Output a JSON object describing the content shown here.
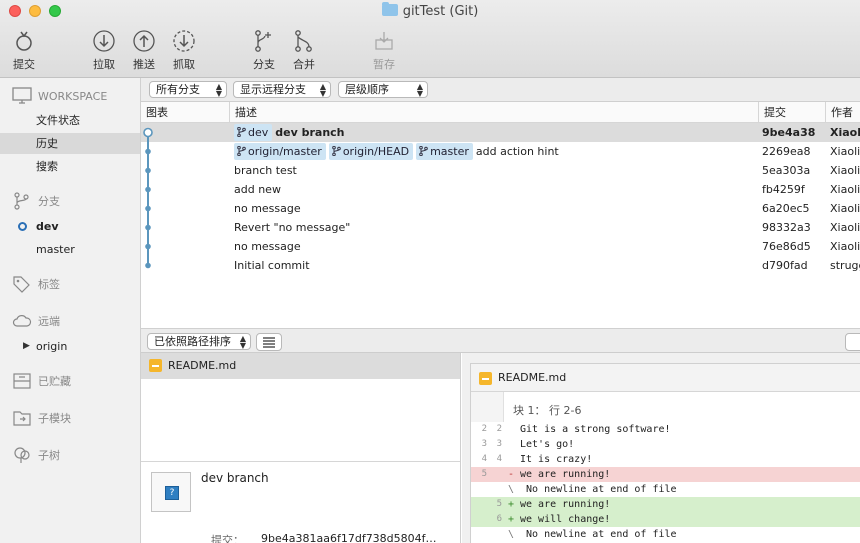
{
  "window": {
    "title": "gitTest (Git)"
  },
  "toolbar": {
    "commit": "提交",
    "pull": "拉取",
    "push": "推送",
    "fetch": "抓取",
    "branch": "分支",
    "merge": "合并",
    "stash": "暂存"
  },
  "sidebar": {
    "workspace": "WORKSPACE",
    "file_status": "文件状态",
    "history": "历史",
    "search": "搜索",
    "branches": "分支",
    "branch_dev": "dev",
    "branch_master": "master",
    "tags": "标签",
    "remotes": "远端",
    "remote_origin": "origin",
    "stashes": "已贮藏",
    "submodules": "子模块",
    "subtrees": "子树"
  },
  "filters": {
    "all_branches": "所有分支",
    "show_remote": "显示远程分支",
    "order": "层级顺序"
  },
  "columns": {
    "graph": "图表",
    "description": "描述",
    "commit": "提交",
    "author": "作者"
  },
  "commits": [
    {
      "tags": [
        "dev"
      ],
      "subject": "dev branch",
      "hash": "9be4a38",
      "author": "Xiaoli"
    },
    {
      "tags": [
        "origin/master",
        "origin/HEAD",
        "master"
      ],
      "subject": "add  action hint",
      "hash": "2269ea8",
      "author": "Xiaoli"
    },
    {
      "tags": [],
      "subject": "branch test",
      "hash": "5ea303a",
      "author": "Xiaoli"
    },
    {
      "tags": [],
      "subject": "add new",
      "hash": "fb4259f",
      "author": "Xiaoli"
    },
    {
      "tags": [],
      "subject": "no message",
      "hash": "6a20ec5",
      "author": "Xiaoli"
    },
    {
      "tags": [],
      "subject": "Revert \"no message\"",
      "hash": "98332a3",
      "author": "Xiaoli"
    },
    {
      "tags": [],
      "subject": "no message",
      "hash": "76e86d5",
      "author": "Xiaoli"
    },
    {
      "tags": [],
      "subject": "Initial commit",
      "hash": "d790fad",
      "author": "strugg"
    }
  ],
  "files": {
    "sort_label": "已依照路径排序",
    "name": "README.md"
  },
  "details": {
    "subject": "dev branch",
    "commit_label": "提交：",
    "commit_hash": "9be4a381aa6f17df738d5804f…"
  },
  "diff": {
    "file": "README.md",
    "hunk": "块 1： 行 2-6",
    "lines": [
      {
        "type": "ctx",
        "old": "2",
        "new": "2",
        "sign": "",
        "text": "Git is a strong software!"
      },
      {
        "type": "ctx",
        "old": "3",
        "new": "3",
        "sign": "",
        "text": "Let's go!"
      },
      {
        "type": "ctx",
        "old": "4",
        "new": "4",
        "sign": "",
        "text": "It is crazy!"
      },
      {
        "type": "del",
        "old": "5",
        "new": "",
        "sign": "-",
        "text": "we are running!"
      },
      {
        "type": "ctx",
        "old": "",
        "new": "",
        "sign": "\\",
        "text": " No newline at end of file"
      },
      {
        "type": "add",
        "old": "",
        "new": "5",
        "sign": "+",
        "text": "we are running!"
      },
      {
        "type": "add",
        "old": "",
        "new": "6",
        "sign": "+",
        "text": "we will change!"
      },
      {
        "type": "ctx",
        "old": "",
        "new": "",
        "sign": "\\",
        "text": " No newline at end of file"
      }
    ]
  },
  "colors": {
    "graph": "#5b96bd",
    "tag": "#cde4f4",
    "del": "#f6d3d3",
    "add": "#d6efcc"
  }
}
